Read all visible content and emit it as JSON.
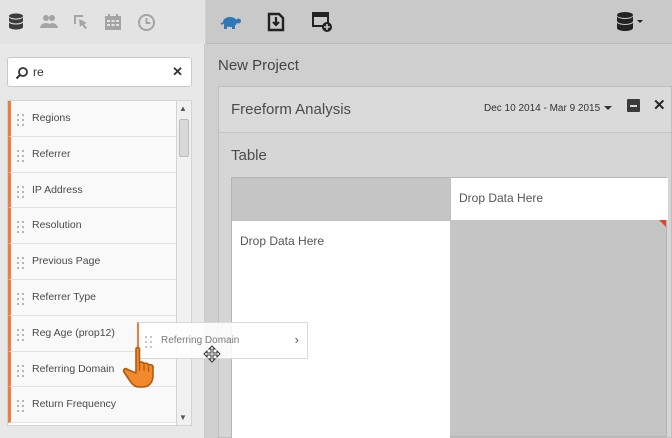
{
  "sidebar": {
    "toolbar_icons": [
      "database-icon",
      "users-icon",
      "pointer-icon",
      "calendar-icon",
      "clock-icon"
    ],
    "search": {
      "value": "re",
      "clear_label": "✕"
    },
    "items": [
      {
        "label": "Regions"
      },
      {
        "label": "Referrer"
      },
      {
        "label": "IP Address"
      },
      {
        "label": "Resolution"
      },
      {
        "label": "Previous Page"
      },
      {
        "label": "Referrer Type"
      },
      {
        "label": "Reg Age (prop12)"
      },
      {
        "label": "Referring Domain"
      },
      {
        "label": "Return Frequency"
      }
    ]
  },
  "main": {
    "toolbar_icons": [
      "turtle-icon",
      "save-icon",
      "add-panel-icon",
      "data-source-icon"
    ],
    "project_title": "New Project",
    "panel": {
      "title": "Freeform Analysis",
      "date_range": "Dec 10 2014 - Mar 9 2015",
      "viz_title": "Table",
      "drop_top": "Drop Data Here",
      "drop_left": "Drop Data Here"
    }
  },
  "drag": {
    "label": "Referring Domain",
    "chevron": "›"
  },
  "colors": {
    "accent": "#ee7d3b",
    "turtle": "#2e78b7",
    "marker": "#e0453a"
  }
}
